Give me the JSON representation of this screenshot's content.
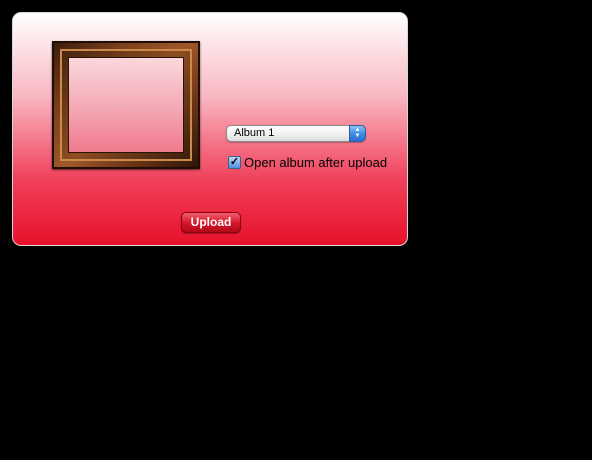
{
  "album_select": {
    "selected": "Album 1",
    "arrow_icon": "updown-arrows-icon"
  },
  "open_album_checkbox": {
    "label": "Open album after upload",
    "checked": true
  },
  "upload_button": {
    "label": "Upload"
  },
  "preview": {
    "icon": "picture-frame-icon"
  },
  "colors": {
    "panel_top": "#ffffff",
    "panel_bottom": "#e8102a",
    "button": "#d8182c",
    "background": "#000000"
  }
}
